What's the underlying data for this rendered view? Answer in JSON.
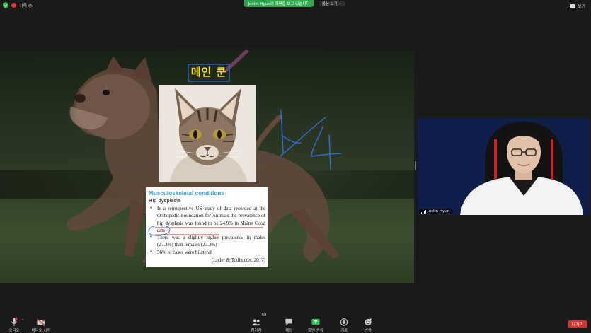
{
  "topbar": {
    "meeting_label": "기록 중",
    "share_banner": "Justin Hyun의 화면을 보고 있습니다",
    "view_options": "옵션 보기",
    "view_options_caret": "⌄",
    "layout_label": "보기"
  },
  "slide": {
    "title": "메인 쿤",
    "card": {
      "heading": "Musculoskeletal conditions",
      "subheading": "Hip dysplasia",
      "bullets": [
        "In a retrospective US study of data recorded at the Orthopedic Foundation for Animals the prevalence of hip dysplasia was found to be 24.9% in Maine Coon cats",
        "There was a slightly higher prevalence in males (27.3%) than females (23.3%)",
        "56% of cases were bilateral"
      ],
      "citation": "(Loder & Todhunter, 2017)"
    },
    "annotation_text": "1/4"
  },
  "participant": {
    "name": "Justin Hyun"
  },
  "toolbar": {
    "audio_label": "오디오",
    "video_label": "비디오 시작",
    "participants_label": "참가자",
    "participants_count": "50",
    "chat_label": "채팅",
    "share_label": "화면 공유",
    "record_label": "기록",
    "reactions_label": "반응",
    "leave_label": "나가기",
    "caret": "^"
  },
  "colors": {
    "banner_green": "#2fa84f",
    "leave_red": "#d6322c",
    "heading_blue": "#3aa4d6",
    "title_yellow": "#f2dd2a",
    "annotation_blue": "#2f6fd6",
    "annotation_red": "#d62b2b"
  }
}
